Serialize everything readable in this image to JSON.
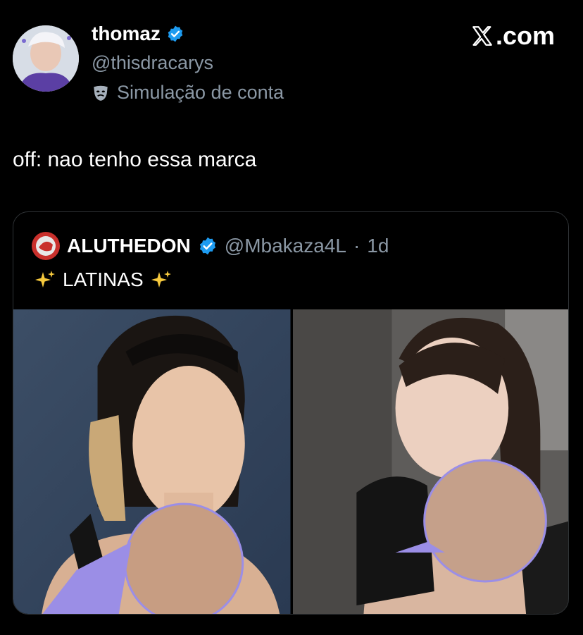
{
  "tweet": {
    "author_name": "thomaz",
    "author_handle": "@thisdracarys",
    "account_label": "Simulação de conta",
    "text": "off: nao tenho essa marca"
  },
  "brand": {
    "label": ".com"
  },
  "quoted": {
    "author_name": "ALUTHEDON",
    "author_handle": "@Mbakaza4L",
    "separator": "·",
    "time": "1d",
    "text": "LATINAS"
  },
  "colors": {
    "verified": "#1d9bf0",
    "highlight": "#9b8ee6",
    "muted": "#8b98a5"
  },
  "icons": [
    "verified-badge-icon",
    "theater-mask-icon",
    "x-logo-icon",
    "sparkles-icon"
  ]
}
